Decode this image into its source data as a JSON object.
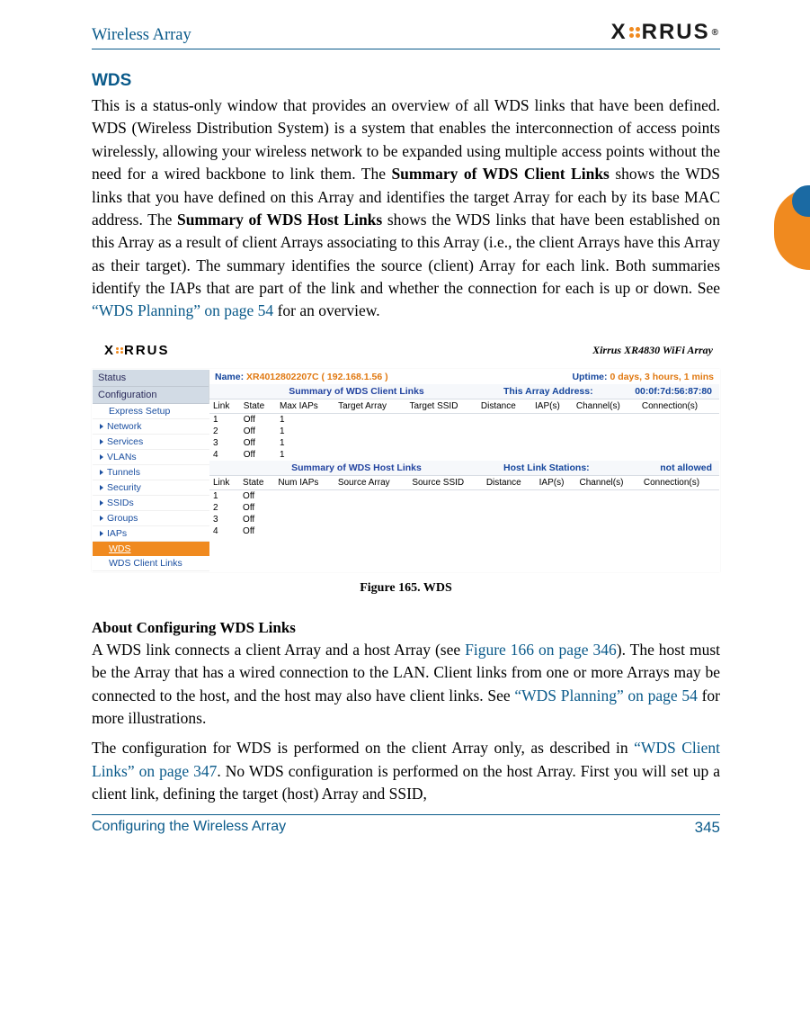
{
  "header": {
    "title": "Wireless Array",
    "logo_text": "XIRRUS"
  },
  "section_heading": "WDS",
  "para1_a": "This is a status-only window that provides an overview of all WDS links that have been defined. WDS (Wireless Distribution System) is a system that enables the interconnection of access points wirelessly, allowing your wireless network to be expanded using multiple access points without the need for a wired backbone to link them. The ",
  "para1_bold1": "Summary of WDS Client Links",
  "para1_b": " shows the WDS links that you have defined on this Array and identifies the target Array for each by its base MAC address. The ",
  "para1_bold2": "Summary of WDS Host Links",
  "para1_c": " shows the WDS links that have been established on this Array as a result of client Arrays associating to this Array (i.e., the client Arrays have this Array as their target). The summary identifies the source (client) Array for each link. Both summaries identify the IAPs that are part of the link and whether the connection for each is up or down. See ",
  "para1_xref": "“WDS Planning” on page 54",
  "para1_d": " for an overview.",
  "figure_caption": "Figure 165. WDS",
  "screenshot": {
    "product_title": "Xirrus XR4830 WiFi Array",
    "logo_text": "XIRRUS",
    "nav": {
      "status": "Status",
      "configuration": "Configuration",
      "items": [
        "Express Setup",
        "Network",
        "Services",
        "VLANs",
        "Tunnels",
        "Security",
        "SSIDs",
        "Groups",
        "IAPs"
      ],
      "active": "WDS",
      "sub": "WDS Client Links"
    },
    "name_label": "Name:",
    "name_value": "XR4012802207C   ( 192.168.1.56 )",
    "uptime_label": "Uptime:",
    "uptime_value": "0 days, 3 hours, 1 mins",
    "client_section": "Summary of WDS Client Links",
    "array_addr_label": "This Array Address:",
    "array_addr_value": "00:0f:7d:56:87:80",
    "client_cols": [
      "Link",
      "State",
      "Max IAPs",
      "Target Array",
      "Target SSID",
      "Distance",
      "IAP(s)",
      "Channel(s)",
      "Connection(s)"
    ],
    "client_rows": [
      {
        "link": "1",
        "state": "Off",
        "max": "1"
      },
      {
        "link": "2",
        "state": "Off",
        "max": "1"
      },
      {
        "link": "3",
        "state": "Off",
        "max": "1"
      },
      {
        "link": "4",
        "state": "Off",
        "max": "1"
      }
    ],
    "host_section": "Summary of WDS Host Links",
    "host_right_label": "Host Link Stations:",
    "host_right_value": "not allowed",
    "host_cols": [
      "Link",
      "State",
      "Num IAPs",
      "Source Array",
      "Source SSID",
      "Distance",
      "IAP(s)",
      "Channel(s)",
      "Connection(s)"
    ],
    "host_rows": [
      {
        "link": "1",
        "state": "Off"
      },
      {
        "link": "2",
        "state": "Off"
      },
      {
        "link": "3",
        "state": "Off"
      },
      {
        "link": "4",
        "state": "Off"
      }
    ]
  },
  "subhead": "About Configuring WDS Links",
  "para2_a": "A WDS link connects a client Array and a host Array (see ",
  "para2_xref1": "Figure 166 on page 346",
  "para2_b": "). The host must be the Array that has a wired connection to the LAN. Client links from one or more Arrays may be connected to the host, and the host may also have client links. See ",
  "para2_xref2": "“WDS Planning” on page 54",
  "para2_c": " for more illustrations.",
  "para3_a": "The configuration for WDS is performed on the client Array only, as described in ",
  "para3_xref": "“WDS Client Links” on page 347",
  "para3_b": ". No WDS configuration is performed on the host Array. First you will set up a client link, defining the target (host) Array and SSID,",
  "footer": {
    "left": "Configuring the Wireless Array",
    "right": "345"
  }
}
